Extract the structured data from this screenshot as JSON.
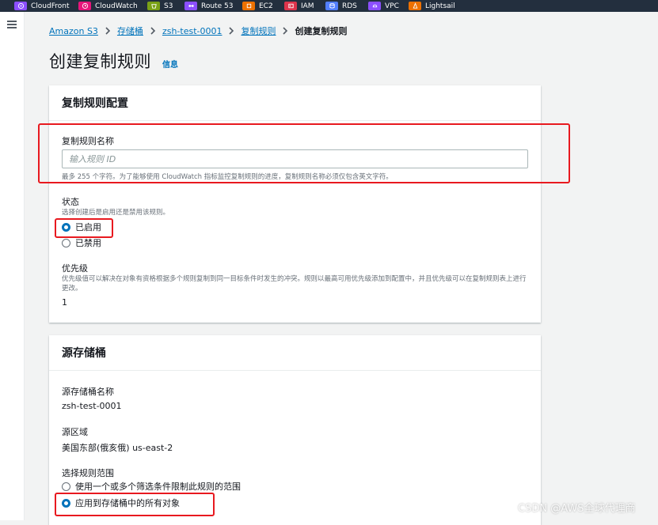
{
  "topbar": {
    "services": [
      {
        "name": "cloudfront-icon",
        "label": "CloudFront",
        "color": "#8c4fff"
      },
      {
        "name": "cloudwatch-icon",
        "label": "CloudWatch",
        "color": "#e7157b"
      },
      {
        "name": "s3-icon",
        "label": "S3",
        "color": "#7aa116"
      },
      {
        "name": "route53-icon",
        "label": "Route 53",
        "color": "#8c4fff"
      },
      {
        "name": "ec2-icon",
        "label": "EC2",
        "color": "#ed7100"
      },
      {
        "name": "iam-icon",
        "label": "IAM",
        "color": "#dd344c"
      },
      {
        "name": "rds-icon",
        "label": "RDS",
        "color": "#527fff"
      },
      {
        "name": "vpc-icon",
        "label": "VPC",
        "color": "#8c4fff"
      },
      {
        "name": "lightsail-icon",
        "label": "Lightsail",
        "color": "#ed7100"
      }
    ]
  },
  "breadcrumb": {
    "items": [
      "Amazon S3",
      "存储桶",
      "zsh-test-0001",
      "复制规则"
    ],
    "current": "创建复制规则"
  },
  "page": {
    "title": "创建复制规则",
    "info": "信息"
  },
  "rule_config": {
    "title": "复制规则配置",
    "name_label": "复制规则名称",
    "name_placeholder": "输入规则 ID",
    "name_value": "",
    "name_hint": "最多 255 个字符。为了能够使用 CloudWatch 指标监控复制规则的进度，复制规则名称必须仅包含英文字符。",
    "status_label": "状态",
    "status_desc": "选择创建后是启用还是禁用该规则。",
    "status_options": [
      "已启用",
      "已禁用"
    ],
    "status_selected": "已启用",
    "priority_label": "优先级",
    "priority_desc": "优先级值可以解决在对象有资格根据多个规则复制到同一目标条件时发生的冲突。规则以最高可用优先级添加到配置中，并且优先级可以在复制规则表上进行更改。",
    "priority_value": "1"
  },
  "source_bucket": {
    "title": "源存储桶",
    "name_label": "源存储桶名称",
    "name_value": "zsh-test-0001",
    "region_label": "源区域",
    "region_value": "美国东部(俄亥俄) us-east-2",
    "scope_label": "选择规则范围",
    "scope_options": [
      "使用一个或多个筛选条件限制此规则的范围",
      "应用到存储桶中的所有对象"
    ],
    "scope_selected": "应用到存储桶中的所有对象"
  },
  "colors": {
    "link": "#0073bb",
    "topbar": "#232f3e",
    "annotation": "#e8191f",
    "radio_selected": "#0073bb"
  },
  "watermark": "CSDN @AWS全球代理商"
}
